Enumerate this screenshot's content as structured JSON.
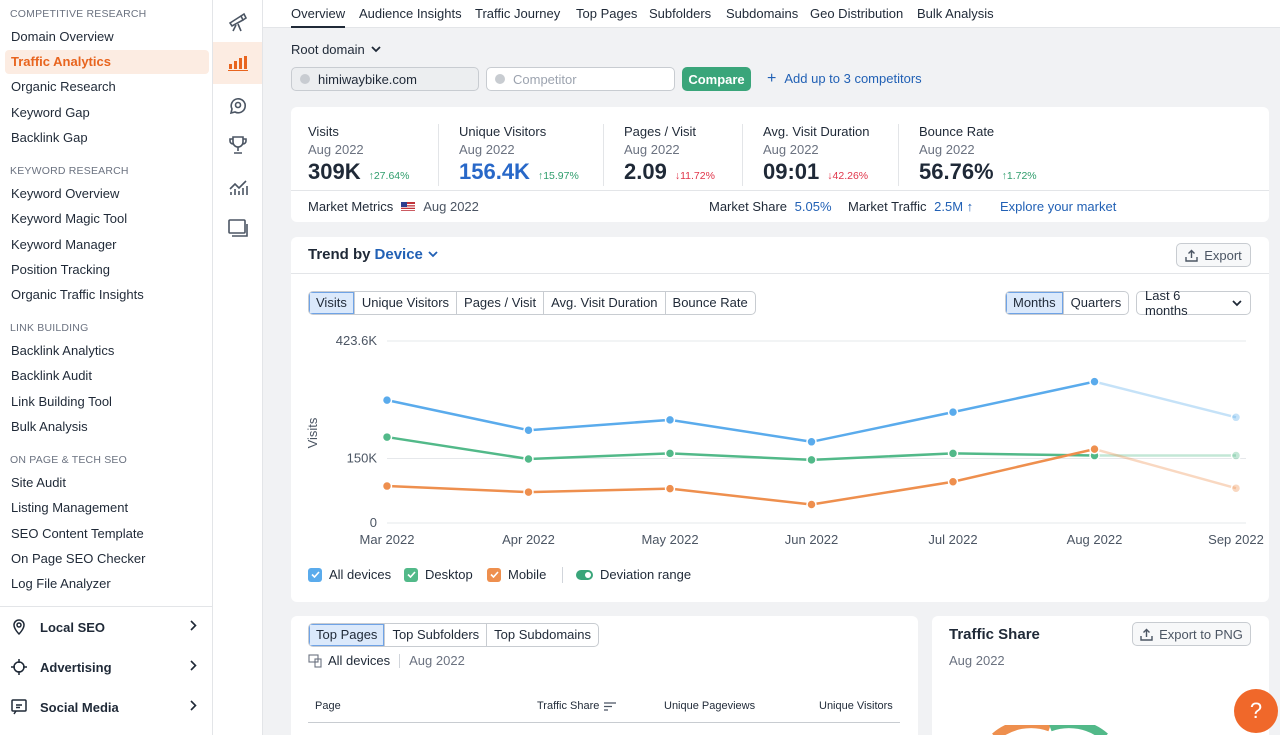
{
  "left_menu": {
    "sections": [
      {
        "heading": "COMPETITIVE RESEARCH",
        "items": [
          "Domain Overview",
          "Traffic Analytics",
          "Organic Research",
          "Keyword Gap",
          "Backlink Gap"
        ]
      },
      {
        "heading": "KEYWORD RESEARCH",
        "items": [
          "Keyword Overview",
          "Keyword Magic Tool",
          "Keyword Manager",
          "Position Tracking",
          "Organic Traffic Insights"
        ]
      },
      {
        "heading": "LINK BUILDING",
        "items": [
          "Backlink Analytics",
          "Backlink Audit",
          "Link Building Tool",
          "Bulk Analysis"
        ]
      },
      {
        "heading": "ON PAGE & TECH SEO",
        "items": [
          "Site Audit",
          "Listing Management",
          "SEO Content Template",
          "On Page SEO Checker",
          "Log File Analyzer"
        ]
      }
    ],
    "active_item": "Traffic Analytics",
    "groups": [
      {
        "label": "Local SEO",
        "icon": "location-pin-icon"
      },
      {
        "label": "Advertising",
        "icon": "target-icon"
      },
      {
        "label": "Social Media",
        "icon": "social-chat-icon"
      }
    ]
  },
  "rail_icons": [
    "telescope-icon",
    "bar-chart-icon",
    "speech-bubble-icon",
    "trophy-icon",
    "trend-chart-icon",
    "layers-icon"
  ],
  "top_tabs": [
    "Overview",
    "Audience Insights",
    "Traffic Journey",
    "Top Pages",
    "Subfolders",
    "Subdomains",
    "Geo Distribution",
    "Bulk Analysis"
  ],
  "active_tab": "Overview",
  "domain_bar": {
    "root_domain_label": "Root domain",
    "domain_value": "himiwaybike.com",
    "competitor_placeholder": "Competitor",
    "compare_label": "Compare",
    "add_competitors_label": "Add up to 3 competitors"
  },
  "metrics": [
    {
      "title": "Visits",
      "date": "Aug 2022",
      "value": "309K",
      "delta": "27.64%",
      "direction": "up",
      "value_color": "#1f2937"
    },
    {
      "title": "Unique Visitors",
      "date": "Aug 2022",
      "value": "156.4K",
      "delta": "15.97%",
      "direction": "up",
      "value_color": "#2868c8"
    },
    {
      "title": "Pages / Visit",
      "date": "Aug 2022",
      "value": "2.09",
      "delta": "11.72%",
      "direction": "down",
      "value_color": "#1f2937"
    },
    {
      "title": "Avg. Visit Duration",
      "date": "Aug 2022",
      "value": "09:01",
      "delta": "42.26%",
      "direction": "down",
      "value_color": "#1f2937"
    },
    {
      "title": "Bounce Rate",
      "date": "Aug 2022",
      "value": "56.76%",
      "delta": "1.72%",
      "direction": "up",
      "value_color": "#1f2937"
    }
  ],
  "market": {
    "label": "Market Metrics",
    "date": "Aug 2022",
    "share_label": "Market Share",
    "share_value": "5.05%",
    "traffic_label": "Market Traffic",
    "traffic_value": "2.5M",
    "explore_label": "Explore your market"
  },
  "trend": {
    "title_prefix": "Trend by",
    "title_dropdown": "Device",
    "export_label": "Export",
    "metric_tabs": [
      "Visits",
      "Unique Visitors",
      "Pages / Visit",
      "Avg. Visit Duration",
      "Bounce Rate"
    ],
    "active_metric": "Visits",
    "period_tabs": [
      "Months",
      "Quarters"
    ],
    "active_period": "Months",
    "range_label": "Last 6 months",
    "legend": [
      {
        "label": "All devices",
        "color": "#5aabec"
      },
      {
        "label": "Desktop",
        "color": "#52b989"
      },
      {
        "label": "Mobile",
        "color": "#ee8f4e"
      }
    ],
    "deviation_label": "Deviation range"
  },
  "chart_data": {
    "type": "line",
    "x": [
      "Mar 2022",
      "Apr 2022",
      "May 2022",
      "Jun 2022",
      "Jul 2022",
      "Aug 2022",
      "Sep 2022"
    ],
    "ylabel": "Visits",
    "yticks": [
      "0",
      "150K",
      "423.6K"
    ],
    "ylim": [
      0,
      423600
    ],
    "series": [
      {
        "name": "All devices",
        "color": "#5aabec",
        "values": [
          286000,
          216000,
          240000,
          189000,
          258000,
          329000,
          246000
        ],
        "last_point_projected": true
      },
      {
        "name": "Desktop",
        "color": "#52b989",
        "values": [
          200000,
          149000,
          162000,
          147000,
          162000,
          157000,
          157000
        ],
        "last_point_projected": true
      },
      {
        "name": "Mobile",
        "color": "#ee8f4e",
        "values": [
          86000,
          72000,
          80000,
          43000,
          96000,
          172000,
          81000
        ],
        "last_point_projected": true
      }
    ],
    "grid": true,
    "legend_position": "bottom-left"
  },
  "top_pages": {
    "tabs": [
      "Top Pages",
      "Top Subfolders",
      "Top Subdomains"
    ],
    "active_tab": "Top Pages",
    "device_label": "All devices",
    "date": "Aug 2022",
    "columns": [
      "Page",
      "Traffic Share",
      "Unique Pageviews",
      "Unique Visitors"
    ]
  },
  "traffic_share": {
    "title": "Traffic Share",
    "export_label": "Export to PNG",
    "date": "Aug 2022"
  },
  "help_label": "?"
}
